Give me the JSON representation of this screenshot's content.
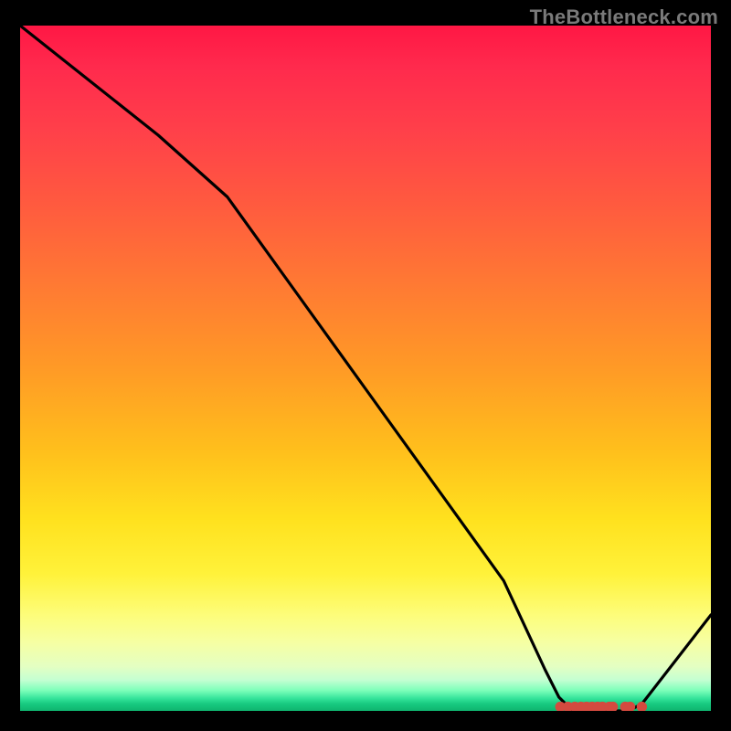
{
  "attribution": "TheBottleneck.com",
  "chart_data": {
    "type": "line",
    "title": "",
    "xlabel": "",
    "ylabel": "",
    "xlim": [
      0,
      100
    ],
    "ylim": [
      0,
      100
    ],
    "x": [
      0,
      10,
      20,
      30,
      40,
      50,
      60,
      70,
      76,
      78,
      80,
      82,
      84,
      86,
      88,
      90,
      100
    ],
    "values": [
      100,
      92,
      84,
      75,
      61,
      47,
      33,
      19,
      6,
      2,
      0,
      0,
      0,
      0,
      0,
      1,
      14
    ],
    "legend": []
  },
  "markers": {
    "xs": [
      78.2,
      79.3,
      80.3,
      81.2,
      82.0,
      82.8,
      83.6,
      84.3,
      85.3,
      85.8,
      87.6,
      88.3,
      90.0
    ],
    "y": 0.6,
    "radius": 0.75
  },
  "note": "Percent-based coordinates; 0 = left/top, 100 = right/bottom for x; y-values are heights from bottom."
}
